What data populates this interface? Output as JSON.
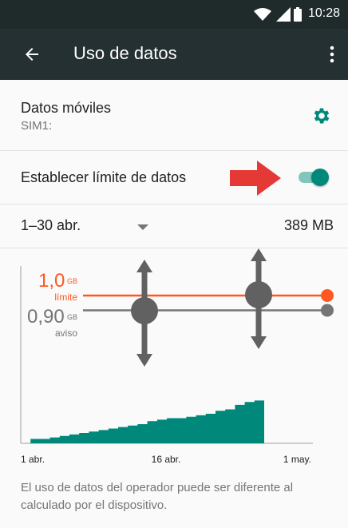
{
  "status_bar": {
    "time": "10:28",
    "icons": [
      "wifi-icon",
      "signal-icon",
      "battery-icon"
    ]
  },
  "app_bar": {
    "title": "Uso de datos",
    "back_icon": "arrow-back-icon",
    "menu_icon": "more-vert-icon"
  },
  "mobile_data": {
    "label": "Datos móviles",
    "sim": "SIM1:",
    "settings_icon": "gear-icon"
  },
  "limit": {
    "label": "Establecer límite de datos",
    "enabled": true
  },
  "cycle": {
    "range": "1–30 abr.",
    "usage": "389 MB"
  },
  "chart": {
    "limit_value": "1,0",
    "limit_unit": "GB",
    "limit_label": "límite",
    "warning_value": "0,90",
    "warning_unit": "GB",
    "warning_label": "aviso",
    "x_labels": [
      "1 abr.",
      "16 abr.",
      "1 may."
    ]
  },
  "chart_data": {
    "type": "area",
    "x": [
      1,
      2,
      3,
      4,
      5,
      6,
      7,
      8,
      9,
      10,
      11,
      12,
      13,
      14,
      15,
      16,
      17,
      18,
      19,
      20,
      21,
      22,
      23,
      24
    ],
    "values": [
      0.03,
      0.03,
      0.04,
      0.05,
      0.06,
      0.07,
      0.08,
      0.09,
      0.1,
      0.11,
      0.12,
      0.13,
      0.15,
      0.16,
      0.17,
      0.17,
      0.18,
      0.19,
      0.2,
      0.22,
      0.23,
      0.26,
      0.28,
      0.29
    ],
    "ylim": [
      0,
      1.2
    ],
    "xlim": [
      1,
      31
    ],
    "limit": 1.0,
    "warning": 0.9
  },
  "footnote": "El uso de datos del operador puede ser diferente al calculado por el dispositivo.",
  "colors": {
    "accent": "#00897b",
    "limit": "#ff5722",
    "warning": "#757575",
    "arrow": "#e53935"
  }
}
